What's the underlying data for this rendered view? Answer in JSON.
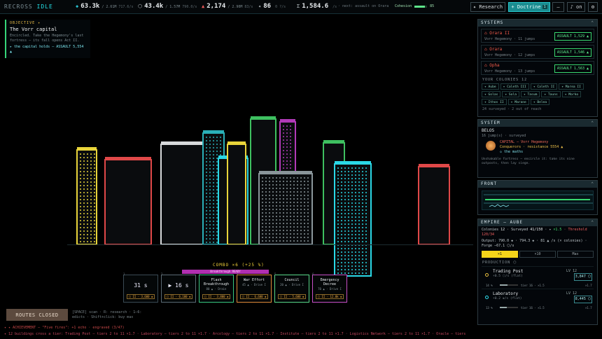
{
  "topbar": {
    "brand_a": "RECROSS",
    "brand_b": "IDLE",
    "resources": [
      {
        "icon": "◈",
        "color": "#2fe0f0",
        "value": "63.3k",
        "sub": "/ 2.61M",
        "rate": "717.6/s"
      },
      {
        "icon": "⬡",
        "color": "#c0c8cc",
        "value": "43.4k",
        "sub": "/ 1.57M",
        "rate": "790.0/s"
      },
      {
        "icon": "▲",
        "color": "#f05a5a",
        "value": "2,174",
        "sub": "/ 2.90M",
        "rate": "83/s"
      },
      {
        "icon": "✦",
        "color": "#c0c8cc",
        "value": "86",
        "sub": "",
        "rate": "0 ?/s"
      },
      {
        "icon": "Σ",
        "color": "#c0c8cc",
        "value": "1,584.6",
        "sub": "",
        "rate": "/s"
      }
    ],
    "next_msg": "· next: assault on Orara",
    "cohesion_label": "Cohesion",
    "cohesion_value": "85",
    "cohesion_fraction": 0.85,
    "research_btn": "✦ Research",
    "doctrine_btn": "+ Doctrine",
    "doctrine_badge": "1",
    "minus_btn": "—",
    "sound_btn": "♪ on",
    "gear_btn": "⚙"
  },
  "objective": {
    "header": "OBJECTIVE ✦",
    "title": "The Vorr capital",
    "desc": "Encircled. Take the Hegemony's last fortress — its fall opens Act II.",
    "goal": "▸ the capital holds — ASSAULT 5,554 ▲"
  },
  "combo": {
    "label": "COMBO ×6 (+25 %)",
    "bar_text": "Breakthrough READY"
  },
  "cards": [
    {
      "num": "1",
      "big": "31 s",
      "title": "",
      "sub": "",
      "cost": "⬡ II · 3,600 ◈"
    },
    {
      "num": "2",
      "big": "▶ 16 s",
      "title": "",
      "sub": "",
      "cost": "⬡ II · 6,100 ◈"
    },
    {
      "num": "3",
      "big": "",
      "title": "Flash Breakthrough",
      "sub": "80 ▲ · Drain",
      "cost": "⬡ II · 3,800 ◈"
    },
    {
      "num": "4",
      "big": "",
      "title": "War Effort",
      "sub": "45 ▲ · Drive I",
      "cost": "⬡ II · 6,600 ◈"
    },
    {
      "num": "5",
      "big": "",
      "title": "Council",
      "sub": "20 ▲ · Drive I",
      "cost": "⬡ II · 5,600 ◈"
    },
    {
      "num": "6",
      "big": "",
      "title": "Emergency Decree",
      "sub": "70 ▲ · Drive I",
      "cost": "⬡ II · 12.0k ◈"
    }
  ],
  "hint": {
    "line1": "[SPACE] scan · R: research · 1–6:",
    "line2": "edicts · Shift+click: buy max"
  },
  "routes_btn": "ROUTES CLOSED",
  "ticker1": "✦ ✦ ACHIEVEMENT — \"Five fires\": +1 echo · engraved (3/47)",
  "ticker2": "✦ 12 buildings cross a tier: Trading Post — tiers 2 to 11 ×1.7 · Laboratory — tiers 2 to 11 ×1.7 · Arcology — tiers 2 to 11 ×1.7 · Institute — tiers 2 to 11 ×1.7 · Logistics Network — tiers 2 to 11 ×1.7 · Oracle — tiers",
  "systems": {
    "header": "SYSTEMS",
    "collapse": "⌃",
    "targets": [
      {
        "name": "⌂ Orara II",
        "sub": "Vorr Hegemony · 11 jumps",
        "assault": "ASSAULT 1,529 ▲"
      },
      {
        "name": "⌂ Orara",
        "sub": "Vorr Hegemony · 12 jumps",
        "assault": "ASSAULT 1,546 ▲"
      },
      {
        "name": "⌂ Opha",
        "sub": "Vorr Hegemony · 13 jumps",
        "assault": "ASSAULT 1,563 ▲"
      }
    ],
    "colonies_header": "YOUR COLONIES 12",
    "colonies": [
      "✦ Aube",
      "✦ Caleth III",
      "✦ Caleth II",
      "✦ Marea II",
      "✦ Golas",
      "✦ Sola",
      "✦ Tasum",
      "✦ Tauns",
      "✦ Morko",
      "✦ Ithos II",
      "✦ Marane",
      "✦ Belea"
    ],
    "surveyed": "24 surveyed · 2 out of reach"
  },
  "system": {
    "header": "SYSTEM",
    "collapse": "⌃",
    "name": "BELOS",
    "jumps": "16 jump(s) · surveyed",
    "cap1": "CAPITAL — Vorr Hegemony",
    "cap2": "Conquerors · resistance 5554 ▲",
    "cap3": "◇ the maths",
    "desc": "Unshakable fortress — encircle it: take its nine outposts, then lay siege."
  },
  "front": {
    "header": "FRONT",
    "collapse": "⌃"
  },
  "empire": {
    "header": "EMPIRE — AUBE",
    "collapse": "⌃",
    "line1a": "Colonies",
    "line1b": "12",
    "line1c": "· Surveyed",
    "line1d": "41/150",
    "line1e": "· ✦",
    "line1f": "×1.5",
    "line1g": "· Threshold 120/34",
    "line2": "Output: 790.0 ◈ · 794.3 ◈ · 81 ▲ /s (× colonies) · Forge −67.1 ⬡/s",
    "tabs": [
      "×1",
      "×10",
      "Max"
    ],
    "production_header": "PRODUCTION ⬡",
    "buildings": [
      {
        "name": "Trading Post",
        "rate": "+0.5 ⬡/s (flat)",
        "lv": "LV 12",
        "cost": "3,847 ⬡",
        "progress": "14 %",
        "tier": "tier 16 · ×1.5",
        "mult": "×1.7",
        "frac": 0.14,
        "dot": "#e8c040"
      },
      {
        "name": "Laboratory",
        "rate": "+0.2 ◈/s (flat)",
        "lv": "LV 12",
        "cost": "8,445 ⬡",
        "progress": "13 %",
        "tier": "tier 16 · ×1.5",
        "mult": "×1.7",
        "frac": 0.13,
        "dot": "#2fe0f0"
      }
    ]
  }
}
